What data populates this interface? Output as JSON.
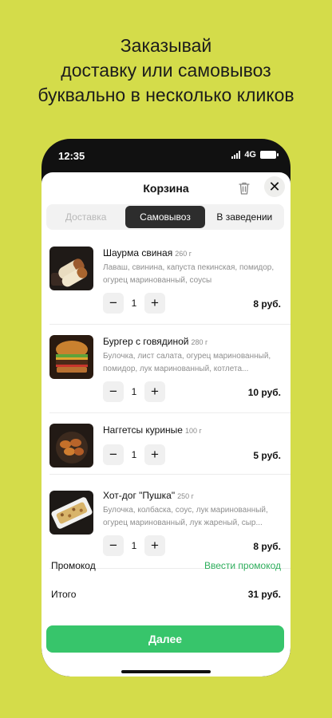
{
  "headline": [
    "Заказывай",
    "доставку или самовывоз",
    "буквально в несколько кликов"
  ],
  "status": {
    "time": "12:35",
    "network": "4G"
  },
  "header": {
    "title": "Корзина"
  },
  "tabs": [
    {
      "label": "Доставка",
      "state": "disabled"
    },
    {
      "label": "Самовывоз",
      "state": "active"
    },
    {
      "label": "В заведении",
      "state": "normal"
    }
  ],
  "items": [
    {
      "name": "Шаурма свиная",
      "weight": "260 г",
      "description": "Лаваш, свинина, капуста пекинская, помидор, огурец маринованный, соусы",
      "qty": "1",
      "price": "8 руб."
    },
    {
      "name": "Бургер с говядиной",
      "weight": "280 г",
      "description": "Булочка, лист салата, огурец маринованный, помидор, лук маринованный, котлета...",
      "qty": "1",
      "price": "10 руб."
    },
    {
      "name": "Наггетсы куриные",
      "weight": "100 г",
      "description": "",
      "qty": "1",
      "price": "5 руб."
    },
    {
      "name": "Хот-дог \"Пушка\"",
      "weight": "250 г",
      "description": "Булочка, колбаска, соус, лук маринованный, огурец маринованный, лук жареный, сыр...",
      "qty": "1",
      "price": "8 руб."
    }
  ],
  "promo": {
    "label": "Промокод",
    "link": "Ввести промокод"
  },
  "total": {
    "label": "Итого",
    "value": "31 руб."
  },
  "next_button": "Далее",
  "colors": {
    "background": "#d4dc4a",
    "accent": "#37c56b",
    "link": "#2eae5c"
  }
}
